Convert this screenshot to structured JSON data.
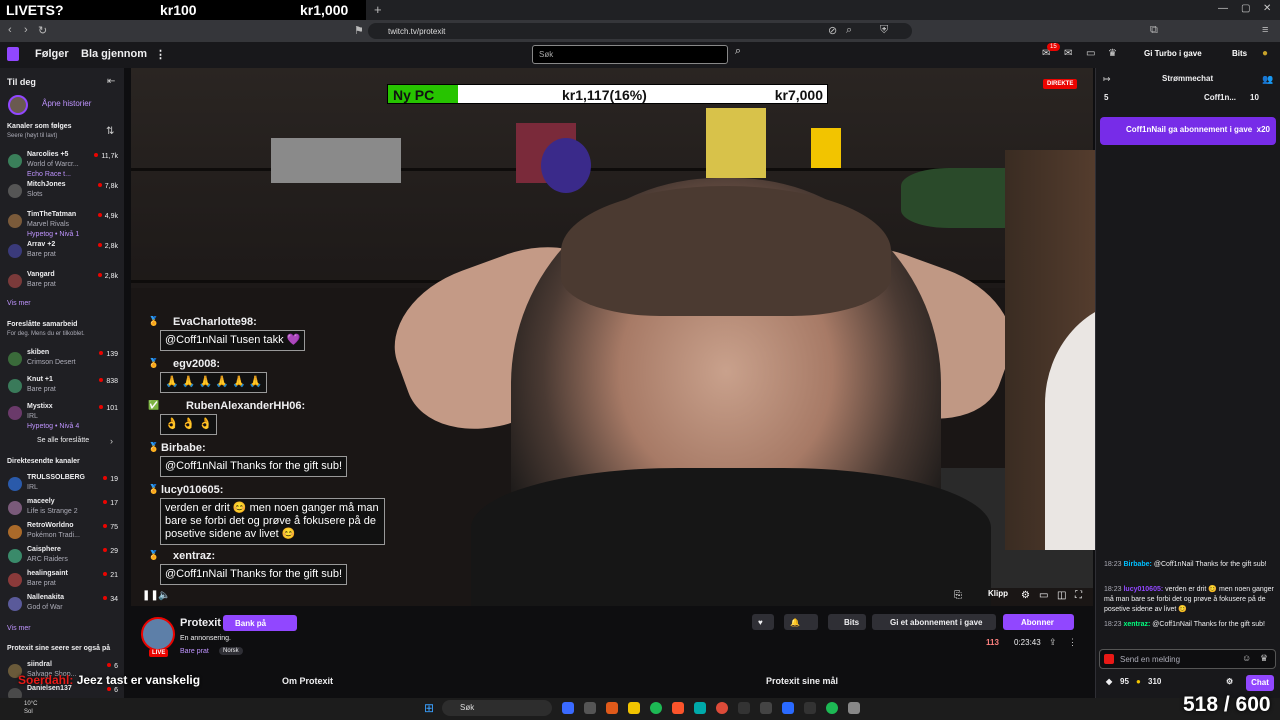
{
  "overlay_tabs": {
    "left": "LIVETS?",
    "mid": "kr100",
    "right": "kr1,000"
  },
  "browser": {
    "url": "twitch.tv/protexit"
  },
  "topbar": {
    "nav_following": "Følger",
    "nav_browse": "Bla gjennom",
    "search_placeholder": "Søk",
    "notif_count": "15",
    "turbo": "Gi Turbo i gave",
    "bits": "Bits"
  },
  "sidebar": {
    "header": "Til deg",
    "stories": "Åpne historier",
    "followed_title": "Kanaler som følges",
    "followed_sub": "Seere (høyt til lavt)",
    "followed": [
      {
        "name": "Narcolies +5",
        "game": "World of Warcr...",
        "extra": "Echo Race t...",
        "viewers": "11,7k",
        "color": "#3a7f5a"
      },
      {
        "name": "MitchJones",
        "game": "Slots",
        "viewers": "7,8k",
        "color": "#555555"
      },
      {
        "name": "TimTheTatman",
        "game": "Marvel Rivals",
        "extra": "Hypetog • Nivå 1",
        "viewers": "4,9k",
        "color": "#7a5a3a"
      },
      {
        "name": "Arrav +2",
        "game": "Bare prat",
        "viewers": "2,8k",
        "color": "#3a3a7a"
      },
      {
        "name": "Vangard",
        "game": "Bare prat",
        "viewers": "2,8k",
        "color": "#7a3a3a"
      }
    ],
    "see_more": "Vis mer",
    "collab_title": "Foreslåtte samarbeid",
    "collab_sub": "For deg. Mens du er tilkoblet.",
    "collab": [
      {
        "name": "skiben",
        "game": "Crimson Desert",
        "viewers": "139",
        "color": "#3a6a3a"
      },
      {
        "name": "Knut +1",
        "game": "Bare prat",
        "viewers": "838",
        "color": "#3a7a5a"
      },
      {
        "name": "Mystixx",
        "game": "IRL",
        "extra": "Hypetog • Nivå 4",
        "viewers": "101",
        "color": "#6a3a6a"
      }
    ],
    "see_all": "Se alle foreslåtte",
    "live_title": "Direktesendte kanaler",
    "live": [
      {
        "name": "TRULSSOLBERG",
        "game": "IRL",
        "viewers": "19",
        "color": "#2a5aaa"
      },
      {
        "name": "maceely",
        "game": "Life is Strange 2",
        "viewers": "17",
        "color": "#7a5a7a"
      },
      {
        "name": "RetroWorldno",
        "game": "Pokémon Tradi...",
        "viewers": "75",
        "color": "#aa6a2a"
      },
      {
        "name": "Caisphere",
        "game": "ARC Raiders",
        "viewers": "29",
        "color": "#3a8a6a"
      },
      {
        "name": "healingsaint",
        "game": "Bare prat",
        "viewers": "21",
        "color": "#8a3a3a"
      },
      {
        "name": "Nallenakita",
        "game": "God of War",
        "viewers": "34",
        "color": "#5a5a9a"
      }
    ],
    "see_more2": "Vis mer",
    "also_title": "Protexit sine seere ser også på",
    "also": [
      {
        "name": "siindral",
        "game": "Salvage Shop...",
        "viewers": "6",
        "color": "#6a5a3a"
      },
      {
        "name": "Danielsen137",
        "game": "",
        "viewers": "6",
        "color": "#4a4a4a"
      }
    ]
  },
  "video": {
    "goal": {
      "label": "Ny PC",
      "current": "kr1,117(16%)",
      "target": "kr7,000",
      "fraction": 0.16
    },
    "live_badge": "DIREKTE",
    "overlay_chat": [
      {
        "user": "EvaCharlotte98:",
        "color": "#2ecc71",
        "msg": "@Coff1nNail Tusen takk 💜"
      },
      {
        "user": "egv2008:",
        "color": "#8a2be2",
        "msg": "🙏 🙏 🙏 🙏 🙏 🙏"
      },
      {
        "user": "RubenAlexanderHH06:",
        "color": "#ff2020",
        "msg": "👌 👌 👌"
      },
      {
        "user": "Birbabe:",
        "color": "#7fffd4",
        "msg": "@Coff1nNail Thanks for the gift sub!"
      },
      {
        "user": "lucy010605:",
        "color": "#8b7fff",
        "msg": "verden er drit 😊 men noen ganger må man bare se forbi det og prøve å fokusere på de posetive sidene av livet 😊"
      },
      {
        "user": "xentraz:",
        "color": "#2ecc71",
        "msg": "@Coff1nNail Thanks for the gift sub!"
      }
    ],
    "clip": "Klipp"
  },
  "chat": {
    "title": "Strømmechat",
    "count_left": "5",
    "top_gifter": "Coff1n...",
    "top_gifter_count": "10",
    "gift_banner": "Coff1nNail ga abonnement i gave",
    "gift_count": "x20",
    "messages": [
      {
        "ts": "18:23",
        "user": "Birbabe:",
        "ucls": "u1",
        "msg": "@Coff1nNail Thanks for the gift sub!"
      },
      {
        "ts": "18:23",
        "user": "lucy010605:",
        "ucls": "u2",
        "msg": "verden er drit 😊 men noen ganger må man bare se forbi det og prøve å fokusere på de posetive sidene av livet 😊"
      },
      {
        "ts": "18:23",
        "user": "xentraz:",
        "ucls": "u3",
        "msg": "@Coff1nNail Thanks for the gift sub!"
      }
    ],
    "input_placeholder": "Send en melding",
    "points1": "95",
    "points2": "310",
    "chat_button": "Chat"
  },
  "streamer": {
    "name": "Protexit",
    "live": "LIVE",
    "support": "Bank på",
    "title": "En annonsering.",
    "category": "Bare prat",
    "tag": "Norsk",
    "bits": "Bits",
    "gift_sub": "Gi et abonnement i gave",
    "subscribe": "Abonner",
    "viewers": "113",
    "uptime": "0:23:43",
    "about": "Om Protexit",
    "goals": "Protexit sine mål"
  },
  "caption": {
    "user": "Soerdahl:",
    "text": "Jeez tast er vanskelig"
  },
  "counter": "518 / 600",
  "taskbar": {
    "search": "Søk",
    "temp": "10°C",
    "weather": "Sol"
  }
}
